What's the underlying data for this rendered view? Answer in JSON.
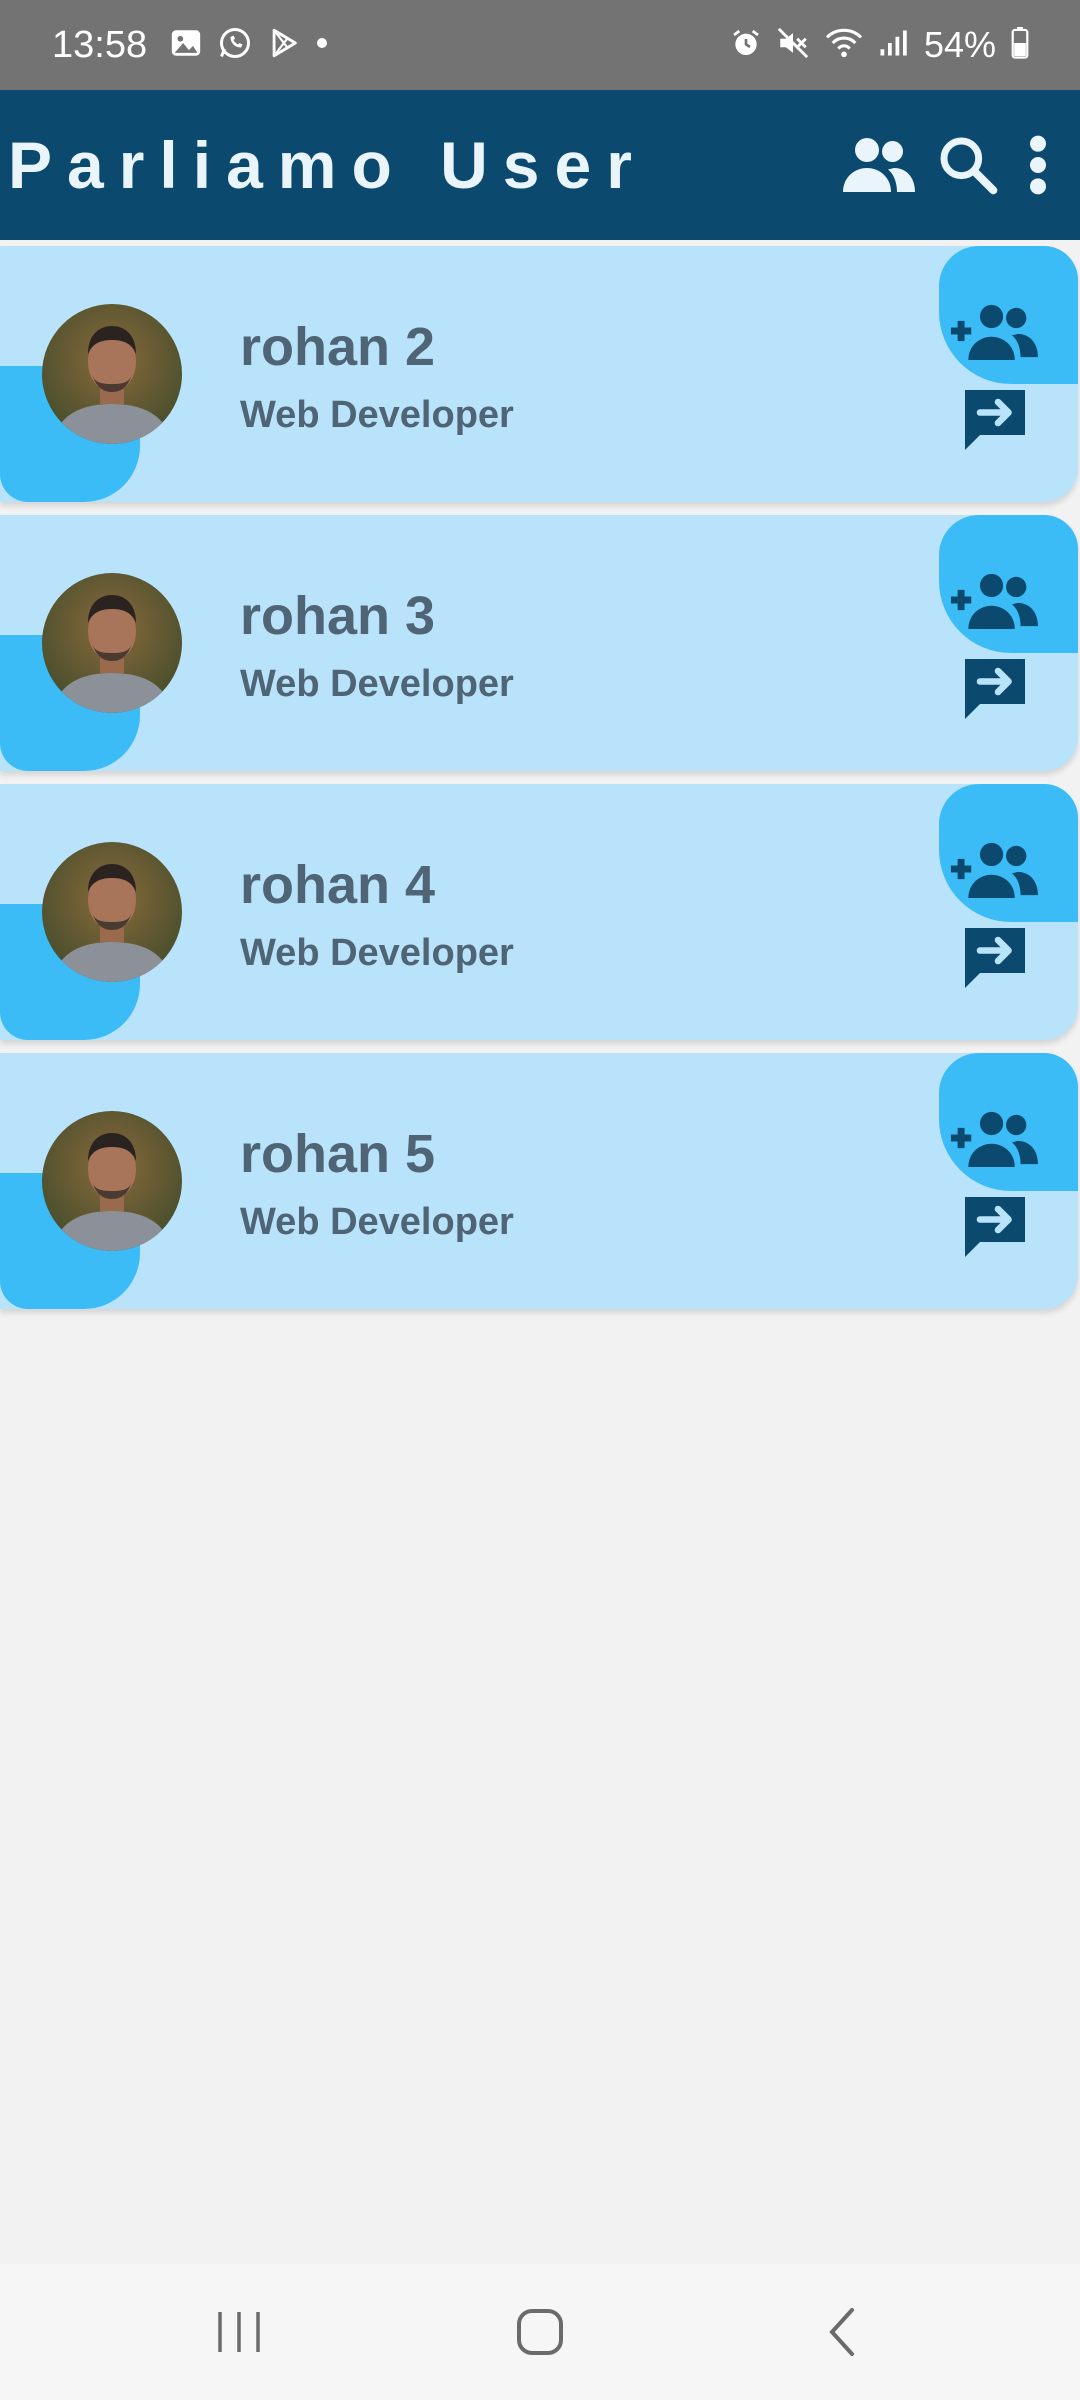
{
  "status_bar": {
    "time": "13:58",
    "left_icons": [
      "gallery-icon",
      "whatsapp-icon",
      "play-store-icon",
      "dot-icon"
    ],
    "right_icons": [
      "alarm-icon",
      "mute-icon",
      "wifi-icon",
      "signal-icon",
      "battery-icon"
    ],
    "battery": "54%"
  },
  "app_bar": {
    "title": "Parliamo User",
    "actions": [
      "groups-icon",
      "search-icon",
      "more-vert-icon"
    ]
  },
  "users": [
    {
      "name": "rohan 2",
      "role": "Web Developer"
    },
    {
      "name": "rohan 3",
      "role": "Web Developer"
    },
    {
      "name": "rohan 4",
      "role": "Web Developer"
    },
    {
      "name": "rohan 5",
      "role": "Web Developer"
    }
  ],
  "colors": {
    "status_bar": "#737373",
    "app_bar": "#0b4a6e",
    "card": "#b8e3fa",
    "accent_blob": "#3bbcf7",
    "text": "#4f6475",
    "background": "#f2f2f2"
  },
  "nav_bar": {
    "buttons": [
      "recent-apps-icon",
      "home-icon",
      "back-icon"
    ]
  }
}
